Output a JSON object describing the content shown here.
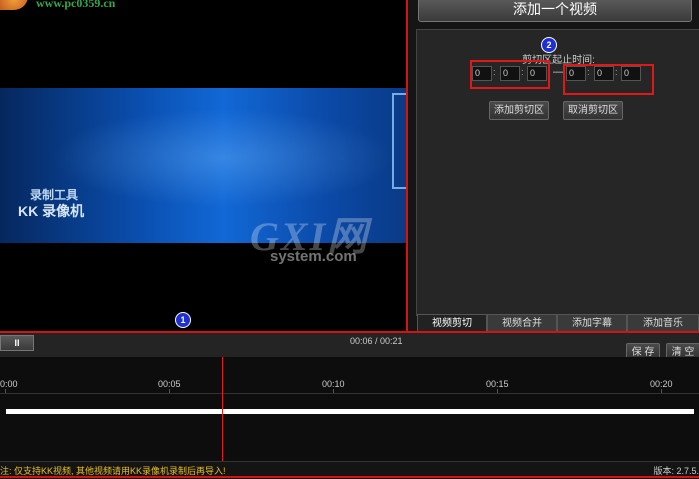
{
  "video_preview": {
    "site_url": "www.pc0359.cn",
    "watermark_line1": "录制工具",
    "watermark_line2": "KK 录像机",
    "overlay_watermark": "GXI网",
    "overlay_watermark_sub": "system.com"
  },
  "markers": {
    "one": "1",
    "two": "2"
  },
  "right_panel": {
    "add_video_label": "添加一个视频",
    "range_label": "剪切区起止时间:",
    "start_time": [
      "0",
      "0",
      "0"
    ],
    "end_time": [
      "0",
      "0",
      "0"
    ],
    "separator": ":",
    "dash": "—",
    "add_clip_label": "添加剪切区",
    "cancel_clip_label": "取消剪切区",
    "tabs": [
      {
        "label": "视频剪切",
        "active": true
      },
      {
        "label": "视频合并",
        "active": false
      },
      {
        "label": "添加字幕",
        "active": false
      },
      {
        "label": "添加音乐",
        "active": false
      }
    ]
  },
  "transport": {
    "pause_label": "II",
    "current_time": "00:06",
    "total_time": "00:21",
    "time_separator": " / ",
    "time_readout": "00:06 / 00:21",
    "save_label": "保 存",
    "clear_label": "清 空"
  },
  "timeline": {
    "ticks": [
      "0:00",
      "00:05",
      "00:10",
      "00:15",
      "00:20"
    ],
    "playhead_seconds": 6
  },
  "status": {
    "note": "注: 仅支持KK视频, 其他视频请用KK录像机录制后再导入!",
    "version": "版本: 2.7.5."
  },
  "colors": {
    "highlight_red": "#e01818",
    "marker_blue": "#1e2fd6",
    "note_yellow": "#e8c020"
  }
}
